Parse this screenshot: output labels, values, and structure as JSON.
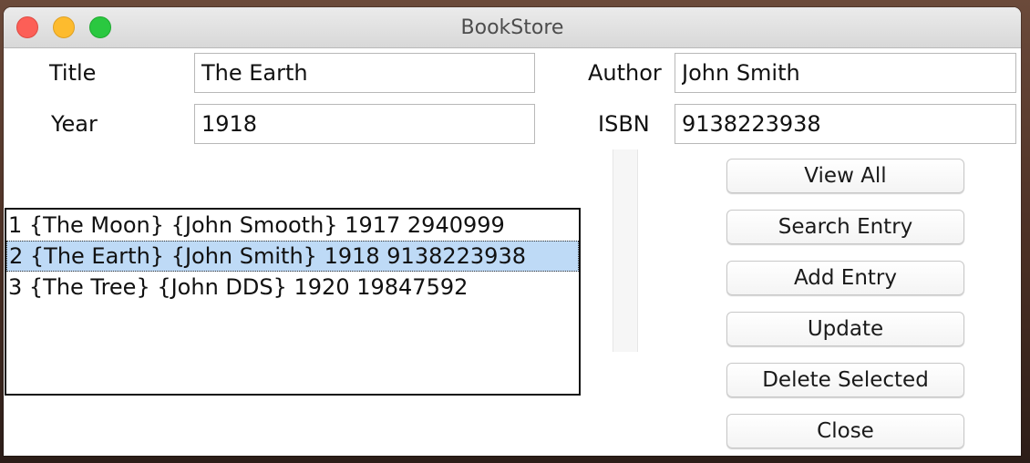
{
  "window": {
    "title": "BookStore"
  },
  "form": {
    "title_label": "Title",
    "title_value": "The Earth",
    "author_label": "Author",
    "author_value": "John Smith",
    "year_label": "Year",
    "year_value": "1918",
    "isbn_label": "ISBN",
    "isbn_value": "9138223938"
  },
  "list": {
    "rows": [
      "1 {The Moon} {John Smooth} 1917 2940999",
      "2 {The Earth} {John Smith} 1918 9138223938",
      "3 {The Tree} {John DDS} 1920 19847592"
    ],
    "selected_index": 1
  },
  "buttons": {
    "view_all": "View All",
    "search_entry": "Search Entry",
    "add_entry": "Add Entry",
    "update": "Update",
    "delete_selected": "Delete Selected",
    "close": "Close"
  },
  "colors": {
    "selection": "#bedaf6",
    "close_light": "#fc5f57",
    "minimize_light": "#fdbb2e",
    "zoom_light": "#2ac840"
  }
}
